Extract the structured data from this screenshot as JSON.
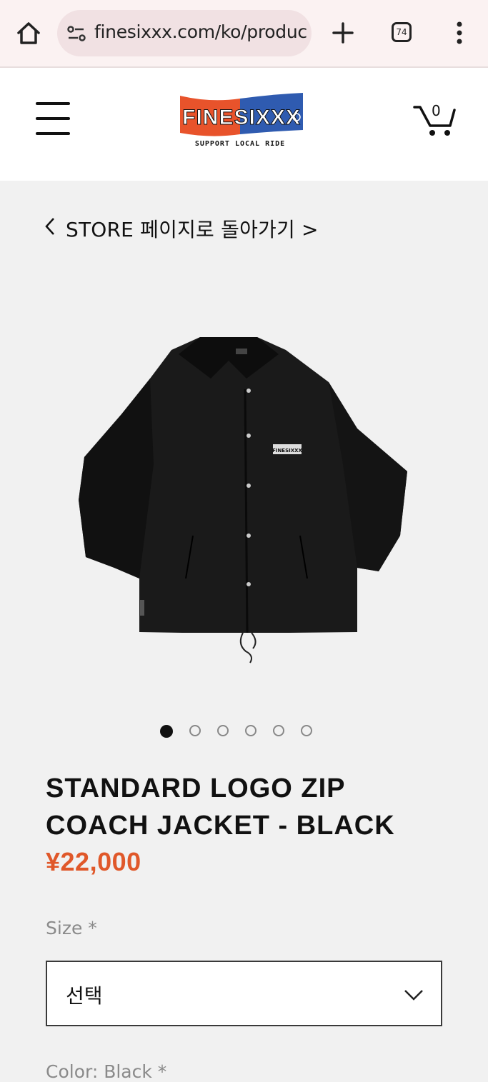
{
  "browser": {
    "url": "finesixxx.com/ko/produc",
    "tab_count": "74",
    "icons": [
      "home-icon",
      "site-info-icon",
      "new-tab-icon",
      "tabs-icon",
      "menu-icon"
    ]
  },
  "header": {
    "logo_text": "FINESIXXX",
    "logo_tagline": "SUPPORT LOCAL RIDE",
    "cart_count": "0",
    "colors": {
      "logo_red": "#e8532b",
      "logo_blue": "#2f5bb0"
    }
  },
  "breadcrumb": {
    "back_label": "STORE 페이지로 돌아가기 >"
  },
  "product": {
    "title_line1": "STANDARD LOGO ZIP",
    "title_line2": "COACH JACKET - BLACK",
    "price": "¥22,000",
    "price_color": "#e0582a",
    "image_count": 6,
    "active_image": 1,
    "garment_logo": "FINESIXXX"
  },
  "options": {
    "size_label": "Size *",
    "size_value": "선택",
    "next_label": "Color: Black *"
  }
}
